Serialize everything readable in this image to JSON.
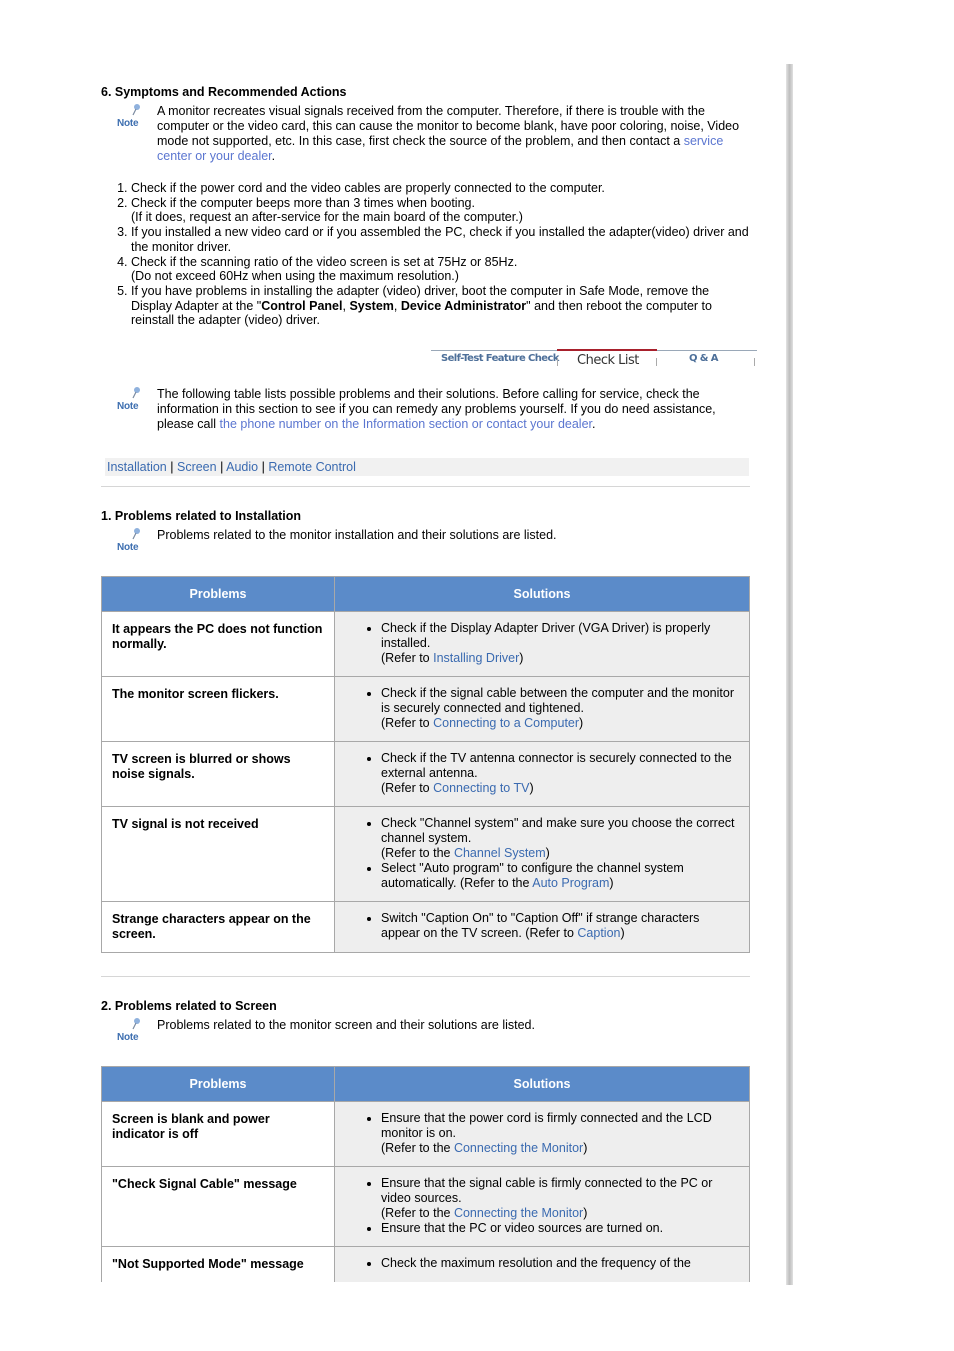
{
  "section6": {
    "title": "6. Symptoms and Recommended Actions",
    "note_label": "Note",
    "note_text": "A monitor recreates visual signals received from the computer. Therefore, if there is trouble with the computer or the video card, this can cause the monitor to become blank, have poor coloring, noise, Video mode not supported, etc. In this case, first check the source of the problem, and then contact a ",
    "note_link": "service center or your dealer",
    "note_end": ".",
    "steps": [
      {
        "text": "Check if the power cord and the video cables are properly connected to the computer."
      },
      {
        "text": "Check if the computer beeps more than 3 times when booting.",
        "sub": "(If it does, request an after-service for the main board of the computer.)"
      },
      {
        "text": "If you installed a new video card or if you assembled the PC, check if you installed the adapter(video) driver and the monitor driver."
      },
      {
        "text": "Check if the scanning ratio of the video screen is set at 75Hz or 85Hz.",
        "sub": "(Do not exceed 60Hz when using the maximum resolution.)"
      },
      {
        "pre": "If you have problems in installing the adapter (video) driver, boot the computer in Safe Mode, remove the Display Adapter at the \"",
        "b1": "Control Panel",
        "c1": ", ",
        "b2": "System",
        "c2": ", ",
        "b3": "Device Administrator",
        "post": "\" and then reboot the computer to reinstall the adapter (video) driver."
      }
    ]
  },
  "tabs": {
    "items": [
      "Self-Test Feature Check",
      "Check List",
      "Q & A"
    ],
    "active": "Check List",
    "active_color": "#a8202c"
  },
  "intro": {
    "note_label": "Note",
    "text": "The following table lists possible problems and their solutions. Before calling for service, check the information in this section to see if you can remedy any problems yourself. If you do need assistance, please call ",
    "link": "the phone number on the Information section or contact your dealer",
    "end": "."
  },
  "nav": {
    "links": [
      "Installation",
      "Screen",
      "Audio",
      "Remote Control"
    ],
    "sep": "|"
  },
  "installation": {
    "title": "1. Problems related to Installation",
    "note_label": "Note",
    "note": "Problems related to the monitor installation and their solutions are listed.",
    "headers": [
      "Problems",
      "Solutions"
    ],
    "rows": [
      {
        "problem": "It appears the PC does not function normally.",
        "solutions": [
          {
            "text": "Check if the Display Adapter Driver (VGA Driver) is properly installed.",
            "ref_pre": "(Refer to ",
            "ref_link": "Installing Driver",
            "ref_post": ")"
          }
        ]
      },
      {
        "problem": "The monitor screen flickers.",
        "solutions": [
          {
            "text": "Check if the signal cable between the computer and the monitor is securely connected and tightened.",
            "ref_pre": "(Refer to ",
            "ref_link": "Connecting to a Computer",
            "ref_post": ")"
          }
        ]
      },
      {
        "problem": "TV screen is blurred or shows noise signals.",
        "solutions": [
          {
            "text": "Check if the TV antenna connector is securely connected to the external antenna.",
            "ref_pre": "(Refer to ",
            "ref_link": "Connecting to TV",
            "ref_post": ")"
          }
        ]
      },
      {
        "problem": "TV signal is not received",
        "solutions": [
          {
            "text": "Check \"Channel system\" and make sure you choose the correct channel system.",
            "ref_pre": "(Refer to the ",
            "ref_link": "Channel System",
            "ref_post": ")"
          },
          {
            "text": "Select \"Auto program\" to configure the channel system automatically. (Refer to the ",
            "inline_link": "Auto Program",
            "inline_post": ")"
          }
        ]
      },
      {
        "problem": "Strange characters appear on the screen.",
        "solutions": [
          {
            "text": "Switch \"Caption On\" to \"Caption Off\" if strange characters appear on the TV screen. (Refer to ",
            "inline_link": "Caption",
            "inline_post": ")"
          }
        ]
      }
    ]
  },
  "screen": {
    "title": "2. Problems related to Screen",
    "note_label": "Note",
    "note": "Problems related to the monitor screen and their solutions are listed.",
    "headers": [
      "Problems",
      "Solutions"
    ],
    "rows": [
      {
        "problem": "Screen is blank and power indicator is off",
        "solutions": [
          {
            "text": "Ensure that the power cord is firmly connected and the LCD monitor is on.",
            "ref_pre": "(Refer to the ",
            "ref_link": "Connecting the Monitor",
            "ref_post": ")"
          }
        ]
      },
      {
        "problem": "\"Check Signal Cable\" message",
        "solutions": [
          {
            "text": "Ensure that the signal cable is firmly connected to the PC or video sources.",
            "ref_pre": "(Refer to the ",
            "ref_link": "Connecting the Monitor",
            "ref_post": ")"
          },
          {
            "text": "Ensure that the PC or video sources are turned on."
          }
        ]
      },
      {
        "problem": "\"Not Supported Mode\" message",
        "solutions": [
          {
            "text": "Check the maximum resolution and the frequency of the"
          }
        ]
      }
    ]
  }
}
